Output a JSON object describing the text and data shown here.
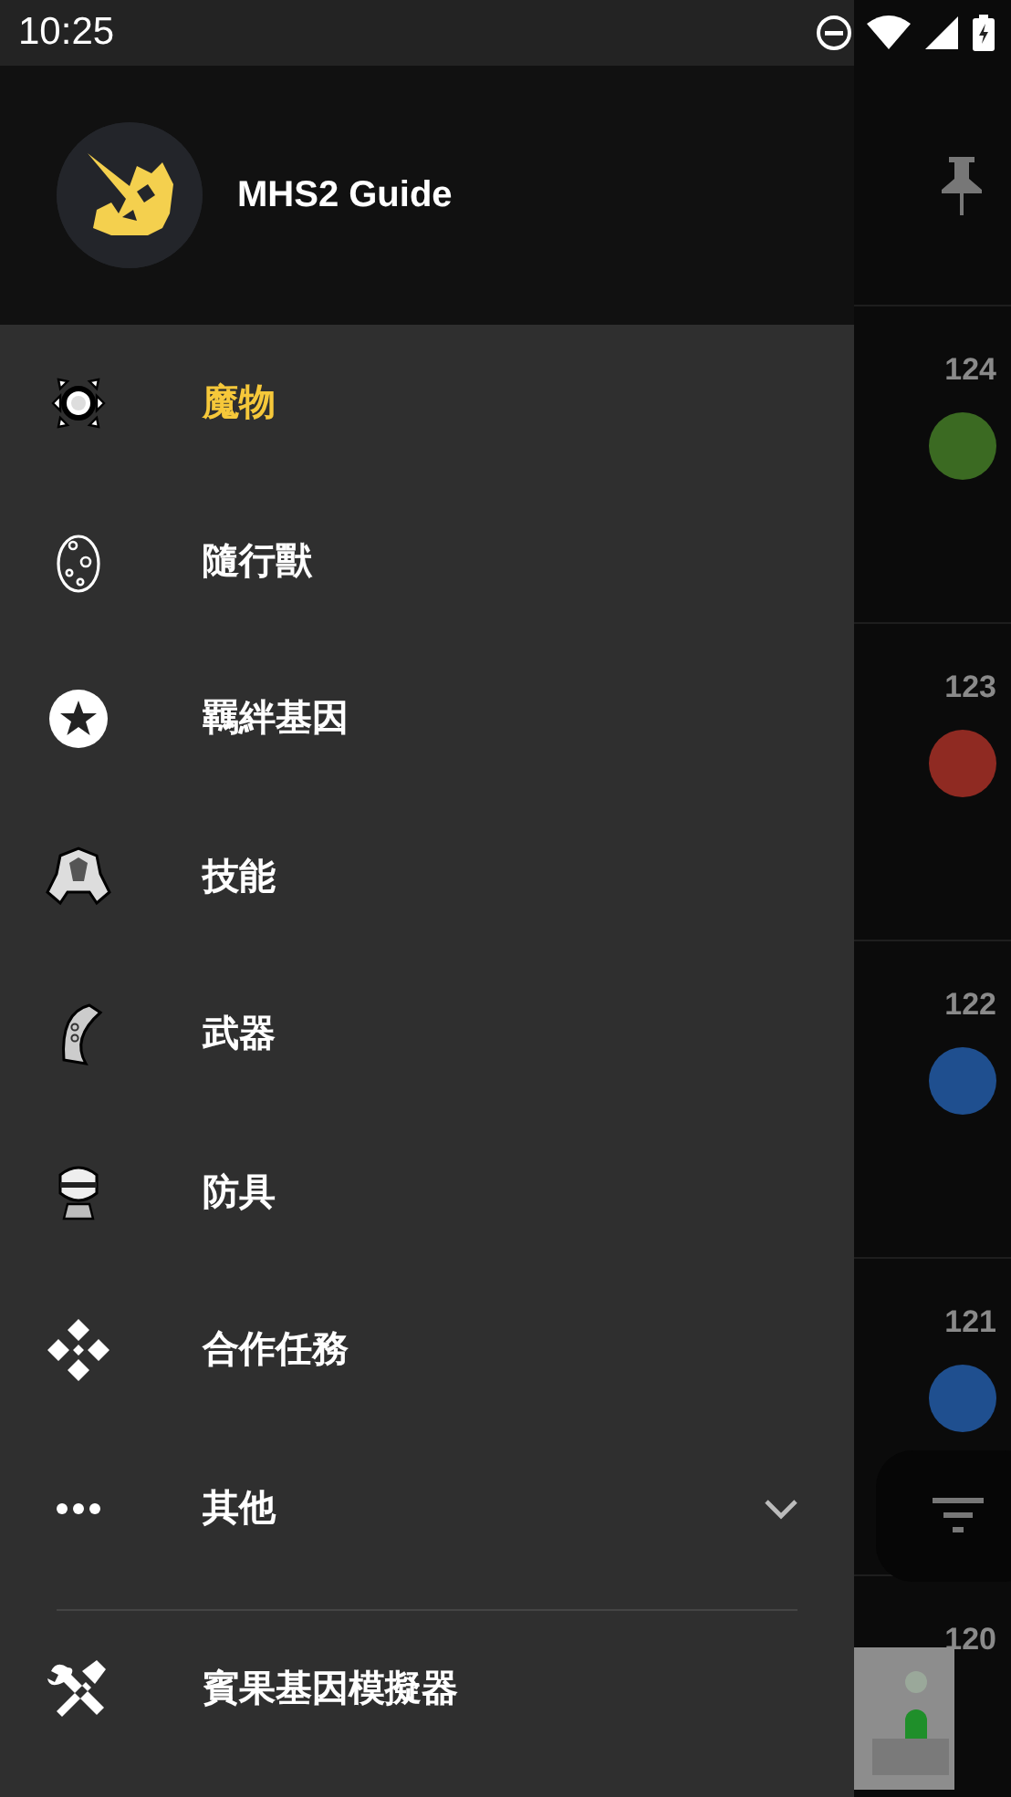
{
  "status_bar": {
    "time": "10:25"
  },
  "drawer": {
    "header": {
      "title": "MHS2 Guide"
    },
    "items": [
      {
        "kind": "link",
        "label": "魔物",
        "selected": true
      },
      {
        "kind": "link",
        "label": "隨行獸",
        "selected": false
      },
      {
        "kind": "link",
        "label": "羈絆基因",
        "selected": false
      },
      {
        "kind": "link",
        "label": "技能",
        "selected": false
      },
      {
        "kind": "link",
        "label": "武器",
        "selected": false
      },
      {
        "kind": "link",
        "label": "防具",
        "selected": false
      },
      {
        "kind": "link",
        "label": "合作任務",
        "selected": false
      },
      {
        "kind": "expandable",
        "label": "其他",
        "selected": false,
        "expanded": false
      },
      {
        "kind": "divider"
      },
      {
        "kind": "link",
        "label": "賓果基因模擬器",
        "selected": false
      }
    ]
  },
  "background_list": {
    "rows": [
      {
        "number": "124",
        "color": "#3b6a22"
      },
      {
        "number": "123",
        "color": "#8f2a22"
      },
      {
        "number": "122",
        "color": "#1f4f8f"
      },
      {
        "number": "121",
        "color": "#1f4f8f"
      },
      {
        "number": "120"
      }
    ]
  }
}
